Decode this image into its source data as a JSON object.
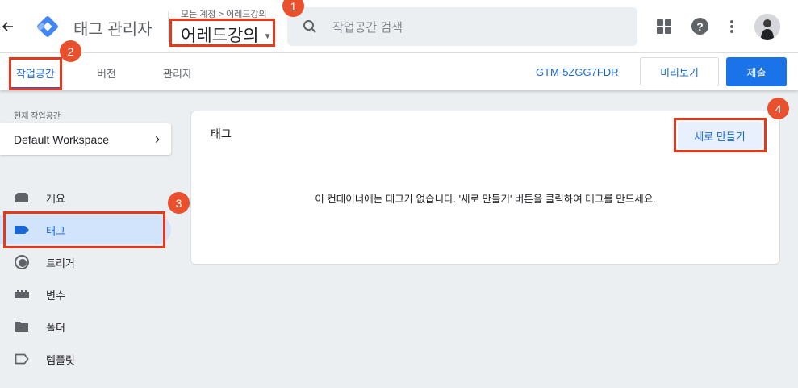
{
  "header": {
    "back_icon": "arrow-left-icon",
    "app_title": "태그 관리자",
    "breadcrumb": "모든 계정 > 어레드강의",
    "container_name": "어레드강의",
    "search_placeholder": "작업공간 검색",
    "logo_color": "#4285f4",
    "accent": "#1967d2"
  },
  "subnav": {
    "tabs": [
      {
        "label": "작업공간",
        "active": true
      },
      {
        "label": "버전",
        "active": false
      },
      {
        "label": "관리자",
        "active": false
      }
    ],
    "container_id": "GTM-5ZGG7FDR",
    "preview_label": "미리보기",
    "submit_label": "제출"
  },
  "sidebar": {
    "workspace_label": "현재 작업공간",
    "workspace_name": "Default Workspace",
    "items": [
      {
        "label": "개요",
        "icon": "overview-icon",
        "active": false
      },
      {
        "label": "태그",
        "icon": "tag-icon",
        "active": true
      },
      {
        "label": "트리거",
        "icon": "trigger-icon",
        "active": false
      },
      {
        "label": "변수",
        "icon": "variable-icon",
        "active": false
      },
      {
        "label": "폴더",
        "icon": "folder-icon",
        "active": false
      },
      {
        "label": "템플릿",
        "icon": "template-icon",
        "active": false
      }
    ]
  },
  "main": {
    "card_title": "태그",
    "new_button": "새로 만들기",
    "empty_message": "이 컨테이너에는 태그가 없습니다. '새로 만들기' 버튼을 클릭하여 태그를 만드세요."
  },
  "annotations": {
    "badges": [
      "1",
      "2",
      "3",
      "4"
    ],
    "color": "#e8381c"
  }
}
